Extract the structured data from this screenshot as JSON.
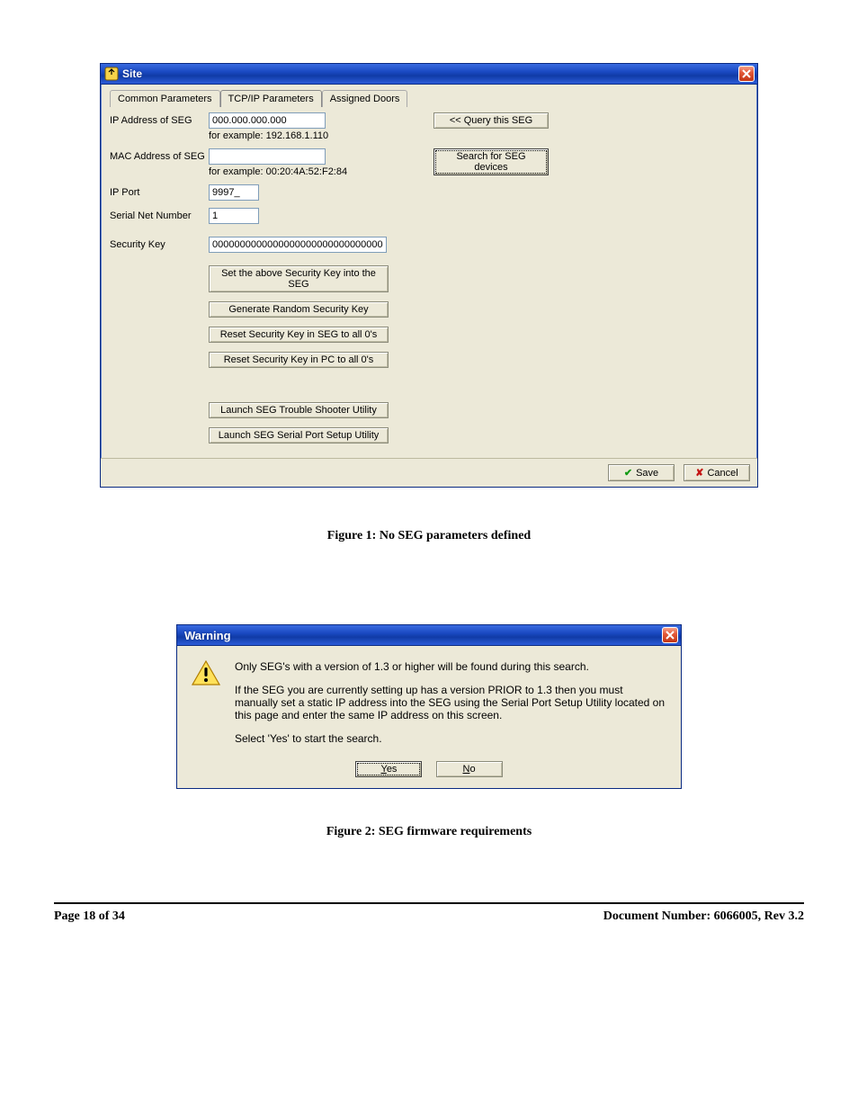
{
  "dialog1": {
    "title": "Site",
    "tabs": {
      "common": "Common Parameters",
      "tcpip": "TCP/IP Parameters",
      "assigned": "Assigned Doors"
    },
    "labels": {
      "ip_address": "IP Address of SEG",
      "mac_address": "MAC Address of SEG",
      "ip_port": "IP Port",
      "serial_net": "Serial Net Number",
      "security_key": "Security Key"
    },
    "values": {
      "ip_address": "000.000.000.000",
      "ip_example": "for example: 192.168.1.110",
      "mac_address": "",
      "mac_example": "for example: 00:20:4A:52:F2:84",
      "ip_port": "9997_",
      "serial_net": "1",
      "security_key": "00000000000000000000000000000000"
    },
    "buttons": {
      "query": "<< Query this SEG",
      "search": "Search for SEG devices",
      "set_key": "Set the above Security Key into the SEG",
      "gen_key": "Generate Random Security Key",
      "reset_seg": "Reset Security Key in SEG to all 0's",
      "reset_pc": "Reset Security Key in PC to all 0's",
      "trouble": "Launch SEG Trouble Shooter Utility",
      "serial_util": "Launch SEG Serial Port Setup Utility",
      "save": "Save",
      "cancel": "Cancel"
    }
  },
  "caption1": "Figure 1: No SEG parameters defined",
  "dialog2": {
    "title": "Warning",
    "line1": "Only SEG's with a version of 1.3 or higher will be found during this search.",
    "line2": "If the SEG you are currently setting up has a version PRIOR to 1.3 then you must manually set a static IP address into the SEG using the Serial Port Setup Utility located on this page and enter the same IP address on this screen.",
    "line3": "Select 'Yes' to start the search.",
    "yes": "Yes",
    "no": "No"
  },
  "caption2": "Figure 2: SEG firmware requirements",
  "footer": {
    "page": "Page 18 of 34",
    "doc": "Document Number: 6066005, Rev 3.2"
  }
}
